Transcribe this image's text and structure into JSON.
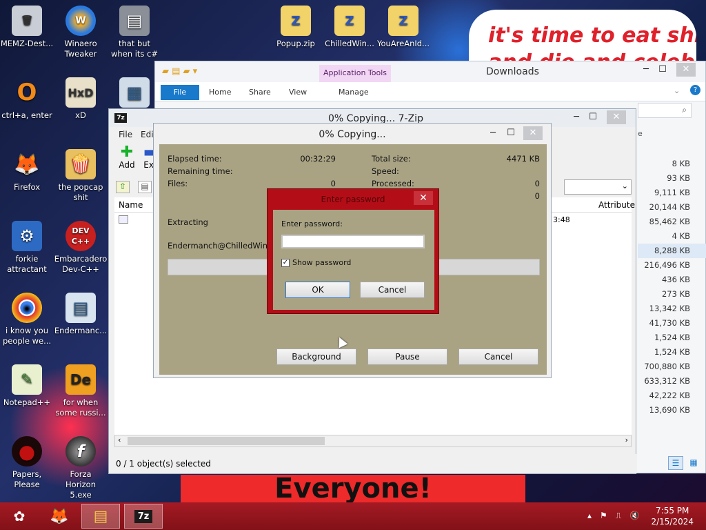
{
  "desktop": {
    "meme_top_line1": "it's time to eat shit",
    "meme_top_line2": "and die and celebrate",
    "meme_bottom": "Everyone!",
    "icons": [
      {
        "label": "MEMZ-Dest...",
        "glyph": "🗑"
      },
      {
        "label": "Winaero Tweaker",
        "glyph": "W"
      },
      {
        "label": "that but when its c#",
        "glyph": "▤"
      },
      {
        "label": "ctrl+a, enter",
        "glyph": "O"
      },
      {
        "label": "xD",
        "glyph": "HxD"
      },
      {
        "label": "",
        "glyph": "▦"
      },
      {
        "label": "Firefox",
        "glyph": "🦊"
      },
      {
        "label": "the popcap shit",
        "glyph": "🍿"
      },
      {
        "label": "forkie attractant",
        "glyph": "⚙"
      },
      {
        "label": "Embarcadero Dev-C++",
        "glyph": "DEV C++"
      },
      {
        "label": "i know you people we...",
        "glyph": "◉"
      },
      {
        "label": "Endermanc...",
        "glyph": "▤"
      },
      {
        "label": "Notepad++",
        "glyph": "✎"
      },
      {
        "label": "for when some russi...",
        "glyph": "De"
      },
      {
        "label": "Papers, Please",
        "glyph": "●"
      },
      {
        "label": "Forza Horizon 5.exe",
        "glyph": "f"
      },
      {
        "label": "Popup.zip",
        "glyph": "Z"
      },
      {
        "label": "ChilledWin...",
        "glyph": "Z"
      },
      {
        "label": "YouAreAnId...",
        "glyph": "Z"
      }
    ]
  },
  "explorer": {
    "title": "Downloads",
    "app_tools": "Application Tools",
    "tabs": [
      "File",
      "Home",
      "Share",
      "View",
      "Manage"
    ],
    "partial_size_header": "e",
    "partial_attr_header": "Attribute",
    "sizes": [
      "8 KB",
      "93 KB",
      "9,111 KB",
      "20,144 KB",
      "85,462 KB",
      "4 KB",
      "8,288 KB",
      "216,496 KB",
      "436 KB",
      "273 KB",
      "13,342 KB",
      "41,730 KB",
      "1,524 KB",
      "1,524 KB",
      "700,880 KB",
      "633,312 KB",
      "42,222 KB",
      "13,690 KB"
    ]
  },
  "zip_main": {
    "title": "0% Copying... 7-Zip",
    "logo": "7z",
    "menu": [
      "File",
      "Edit"
    ],
    "toolbar": {
      "add": "Add",
      "extract": "Ext"
    },
    "list_header_name": "Name",
    "status": "0 / 1 object(s) selected",
    "partial_row_time": "3:48"
  },
  "progress": {
    "title": "0% Copying...",
    "elapsed_label": "Elapsed time:",
    "elapsed_value": "00:32:29",
    "remaining_label": "Remaining time:",
    "files_label": "Files:",
    "files_value": "0",
    "total_size_label": "Total size:",
    "total_size_value": "4471 KB",
    "speed_label": "Speed:",
    "processed_label": "Processed:",
    "processed_value": "0",
    "extra_value": "0",
    "extracting_label": "Extracting",
    "current_file": "Endermanch@ChilledWindows",
    "buttons": {
      "background": "Background",
      "pause": "Pause",
      "cancel": "Cancel"
    }
  },
  "password": {
    "title": "Enter password",
    "label": "Enter password:",
    "value": "",
    "show_password_label": "Show password",
    "ok": "OK",
    "cancel": "Cancel"
  },
  "taskbar": {
    "time": "7:55 PM",
    "date": "2/15/2024",
    "zip_label": "7z"
  }
}
